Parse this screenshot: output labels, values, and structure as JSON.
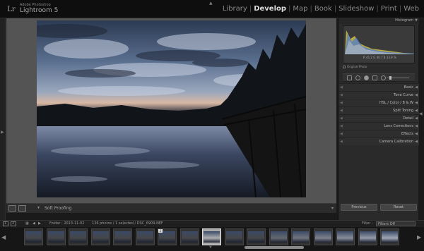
{
  "app": {
    "logo_text": "Lr",
    "brand": "Adobe Photoshop",
    "product": "Lightroom 5"
  },
  "modules": [
    {
      "label": "Library",
      "active": false
    },
    {
      "label": "Develop",
      "active": true
    },
    {
      "label": "Map",
      "active": false
    },
    {
      "label": "Book",
      "active": false
    },
    {
      "label": "Slideshow",
      "active": false
    },
    {
      "label": "Print",
      "active": false
    },
    {
      "label": "Web",
      "active": false
    }
  ],
  "module_separator": "|",
  "toolbar": {
    "soft_proofing_label": "Soft Proofing"
  },
  "right_panel": {
    "histogram_title": "Histogram",
    "hist_info": "R  41.2  G  40.7  B  33.9 %",
    "original_photo_label": "Original Photo",
    "sections": [
      {
        "label": "Basic",
        "side": ""
      },
      {
        "label": "Tone Curve",
        "side": ""
      },
      {
        "label": "HSL / Color / B & W",
        "side": ""
      },
      {
        "label": "Split Toning",
        "side": ""
      },
      {
        "label": "Detail",
        "side": ""
      },
      {
        "label": "Lens Corrections",
        "side": ""
      },
      {
        "label": "Effects",
        "side": ""
      },
      {
        "label": "Camera Calibration",
        "side": ""
      }
    ],
    "previous_button": "Previous",
    "reset_button": "Reset"
  },
  "filmstrip_header": {
    "page1": "1",
    "page2": "2",
    "folder_text": "Folder : 2013-11-02",
    "count_text": "136 photos / 1 selected / DSC_6909.NEF",
    "filter_label": "Filter :",
    "filter_value": "Filters Off"
  },
  "filmstrip": {
    "thumb_count": 17,
    "selected_index": 8,
    "badge_index": 6,
    "badge_text": "2"
  },
  "colors": {
    "background": "#1a1a1a",
    "panel": "#2a2a2a",
    "active_module": "#dddddd"
  }
}
